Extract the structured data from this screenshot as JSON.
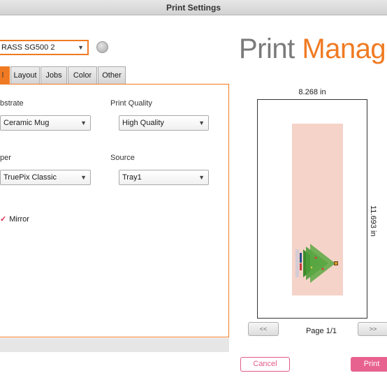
{
  "window": {
    "title": "Print Settings"
  },
  "printer": {
    "selected": "RASS SG500 2"
  },
  "logo": {
    "word1": "Print",
    "word2": "Manage"
  },
  "tabs": [
    "l",
    "Layout",
    "Jobs",
    "Color",
    "Other"
  ],
  "settings": {
    "substrate_label": "bstrate",
    "substrate_value": "Ceramic Mug",
    "quality_label": "Print Quality",
    "quality_value": "High Quality",
    "paper_label": "per",
    "paper_value": "TruePix Classic",
    "source_label": "Source",
    "source_value": "Tray1",
    "mirror_label": "Mirror",
    "mirror_checked": true
  },
  "preview": {
    "width_label": "8.268 in",
    "height_label": "11.693 in",
    "page_indicator": "Page 1/1",
    "prev": "<<",
    "next": ">>"
  },
  "actions": {
    "cancel": "Cancel",
    "print": "Print"
  },
  "colors": {
    "accent": "#f07a22",
    "action": "#e8628f",
    "print_area": "#f5d3c8"
  }
}
